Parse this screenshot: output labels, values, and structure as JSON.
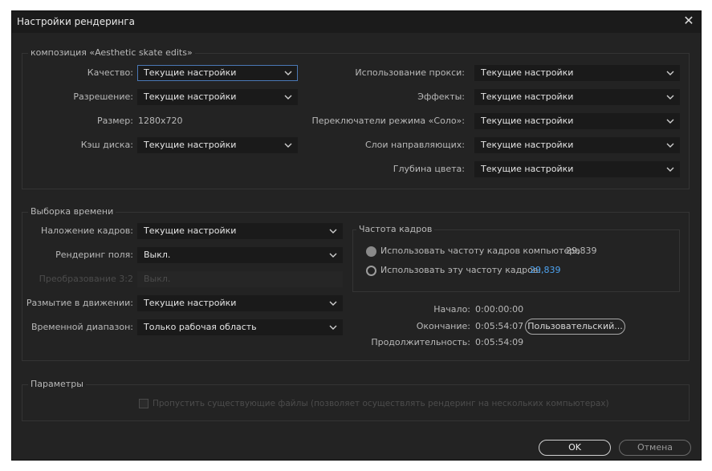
{
  "dialog": {
    "title": "Настройки рендеринга",
    "close_glyph": "✕"
  },
  "composition": {
    "legend": "композиция «Aesthetic skate edits»",
    "quality_label": "Качество:",
    "quality_value": "Текущие настройки",
    "resolution_label": "Разрешение:",
    "resolution_value": "Текущие настройки",
    "size_label": "Размер:",
    "size_value": "1280x720",
    "disk_cache_label": "Кэш диска:",
    "disk_cache_value": "Текущие настройки",
    "proxy_label": "Использование прокси:",
    "proxy_value": "Текущие настройки",
    "effects_label": "Эффекты:",
    "effects_value": "Текущие настройки",
    "solo_label": "Переключатели режима «Соло»:",
    "solo_value": "Текущие настройки",
    "guide_layers_label": "Слои направляющих:",
    "guide_layers_value": "Текущие настройки",
    "color_depth_label": "Глубина цвета:",
    "color_depth_value": "Текущие настройки"
  },
  "time_sampling": {
    "legend": "Выборка времени",
    "frame_blending_label": "Наложение кадров:",
    "frame_blending_value": "Текущие настройки",
    "field_render_label": "Рендеринг поля:",
    "field_render_value": "Выкл.",
    "pulldown_label": "Преобразование 3:2",
    "pulldown_value": "Выкл.",
    "motion_blur_label": "Размытие в движении:",
    "motion_blur_value": "Текущие настройки",
    "time_span_label": "Временной диапазон:",
    "time_span_value": "Только рабочая область",
    "frame_rate": {
      "legend": "Частота кадров",
      "use_comp_label": "Использовать частоту кадров компьютера",
      "use_comp_value": "29,839",
      "use_this_label": "Использовать эту частоту кадров:",
      "use_this_value": "29,839"
    },
    "start_label": "Начало:",
    "start_value": "0:00:00:00",
    "end_label": "Окончание:",
    "end_value": "0:05:54:07",
    "duration_label": "Продолжительность:",
    "duration_value": "0:05:54:09",
    "custom_button": "Пользовательский..."
  },
  "options": {
    "legend": "Параметры",
    "skip_existing_label": "Пропустить существующие файлы (позволяет осуществлять рендеринг на нескольких компьютерах)"
  },
  "buttons": {
    "ok": "OK",
    "cancel": "Отмена"
  },
  "colors": {
    "dialog_bg": "#232323",
    "field_bg": "#1a1a1a",
    "focus_border": "#4a78b5",
    "link_blue": "#4ea3f0"
  }
}
